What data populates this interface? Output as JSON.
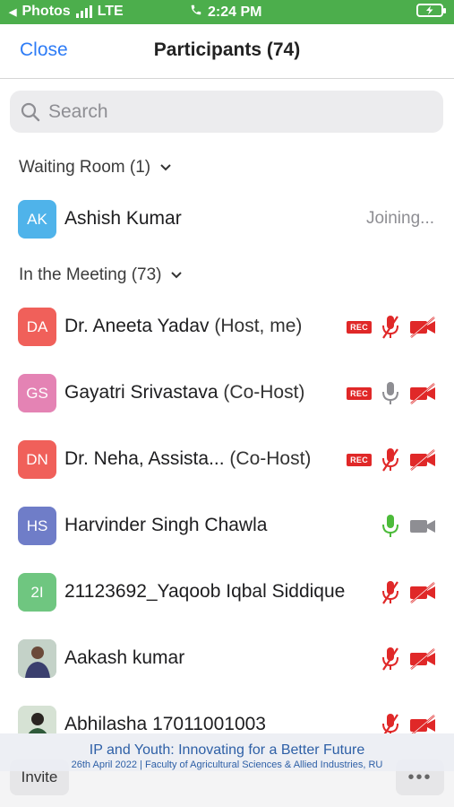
{
  "status_bar": {
    "back_app": "Photos",
    "network": "LTE",
    "time": "2:24 PM"
  },
  "header": {
    "close_label": "Close",
    "title": "Participants (74)"
  },
  "search": {
    "placeholder": "Search"
  },
  "waiting_room": {
    "label": "Waiting Room (1)",
    "participants": [
      {
        "initials": "AK",
        "name": "Ashish Kumar",
        "status": "Joining..."
      }
    ]
  },
  "meeting": {
    "label": "In the Meeting (73)",
    "participants": [
      {
        "initials": "DA",
        "name": "Dr. Aneeta Yadav",
        "role": "(Host, me)",
        "rec": "REC"
      },
      {
        "initials": "GS",
        "name": "Gayatri Srivastava",
        "role": "(Co-Host)",
        "rec": "REC"
      },
      {
        "initials": "DN",
        "name": "Dr. Neha, Assista...",
        "role": "(Co-Host)",
        "rec": "REC"
      },
      {
        "initials": "HS",
        "name": "Harvinder Singh Chawla"
      },
      {
        "initials": "2I",
        "name": "21123692_Yaqoob Iqbal Siddique"
      },
      {
        "name": "Aakash kumar"
      },
      {
        "name": "Abhilasha 17011001003"
      }
    ]
  },
  "footer": {
    "invite_label": "Invite",
    "more_label": "•••"
  },
  "banner": {
    "title": "IP and Youth: Innovating for a Better Future",
    "subtitle": "26th April 2022  |  Faculty of Agricultural Sciences & Allied Industries, RU"
  },
  "colors": {
    "status_bar": "#4cae4c",
    "accent": "#2e7cf6",
    "muted_red": "#e02828",
    "unmuted_green": "#4cbb3a",
    "avatar_red": "#f0605a",
    "avatar_pink": "#e483b4",
    "avatar_blue": "#4fb3ea",
    "avatar_indigo": "#6f7dc8",
    "avatar_green": "#6fc680"
  }
}
